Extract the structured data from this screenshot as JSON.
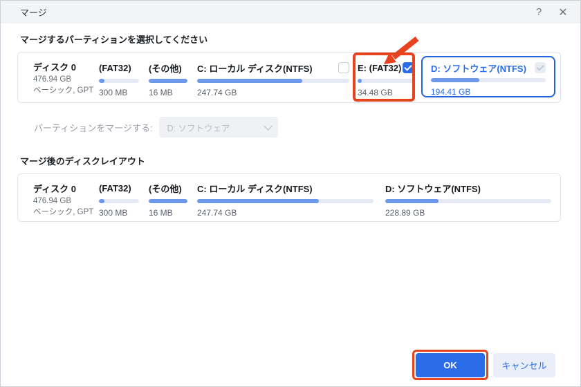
{
  "window": {
    "title": "マージ",
    "help_glyph": "?",
    "close_glyph": "✕"
  },
  "colors": {
    "accent_blue": "#2b6de8",
    "bar_fill": "#6d97e8",
    "bar_track": "#e4e9f3",
    "annotation_red": "#e8431f"
  },
  "select_section": {
    "label": "マージするパーティションを選択してください"
  },
  "source_disk": {
    "name": "ディスク 0",
    "size": "476.94 GB",
    "type": "ベーシック, GPT",
    "partitions": [
      {
        "label": "(FAT32)",
        "size": "300 MB",
        "fill": 14
      },
      {
        "label": "(その他)",
        "size": "16 MB",
        "fill": 100
      },
      {
        "label": "C: ローカル ディスク(NTFS)",
        "size": "247.74 GB",
        "fill": 69,
        "checkbox": "unchecked"
      },
      {
        "label": "E: (FAT32)",
        "size": "34.48 GB",
        "fill": 8,
        "checkbox": "checked",
        "annotated": true
      },
      {
        "label": "D: ソフトウェア(NTFS)",
        "size": "194.41 GB",
        "fill": 42,
        "checkbox": "checked-disabled",
        "selected": true
      }
    ]
  },
  "merge_target": {
    "label": "パーティションをマージする:",
    "value": "D: ソフトウェア",
    "disabled": true
  },
  "layout_section": {
    "label": "マージ後のディスクレイアウト"
  },
  "result_disk": {
    "name": "ディスク 0",
    "size": "476.94 GB",
    "type": "ベーシック, GPT",
    "partitions": [
      {
        "label": "(FAT32)",
        "size": "300 MB",
        "fill": 14
      },
      {
        "label": "(その他)",
        "size": "16 MB",
        "fill": 100
      },
      {
        "label": "C: ローカル ディスク(NTFS)",
        "size": "247.74 GB",
        "fill": 69
      },
      {
        "label": "D: ソフトウェア(NTFS)",
        "size": "228.89 GB",
        "fill": 32
      }
    ]
  },
  "footer": {
    "ok_label": "OK",
    "cancel_label": "キャンセル"
  }
}
